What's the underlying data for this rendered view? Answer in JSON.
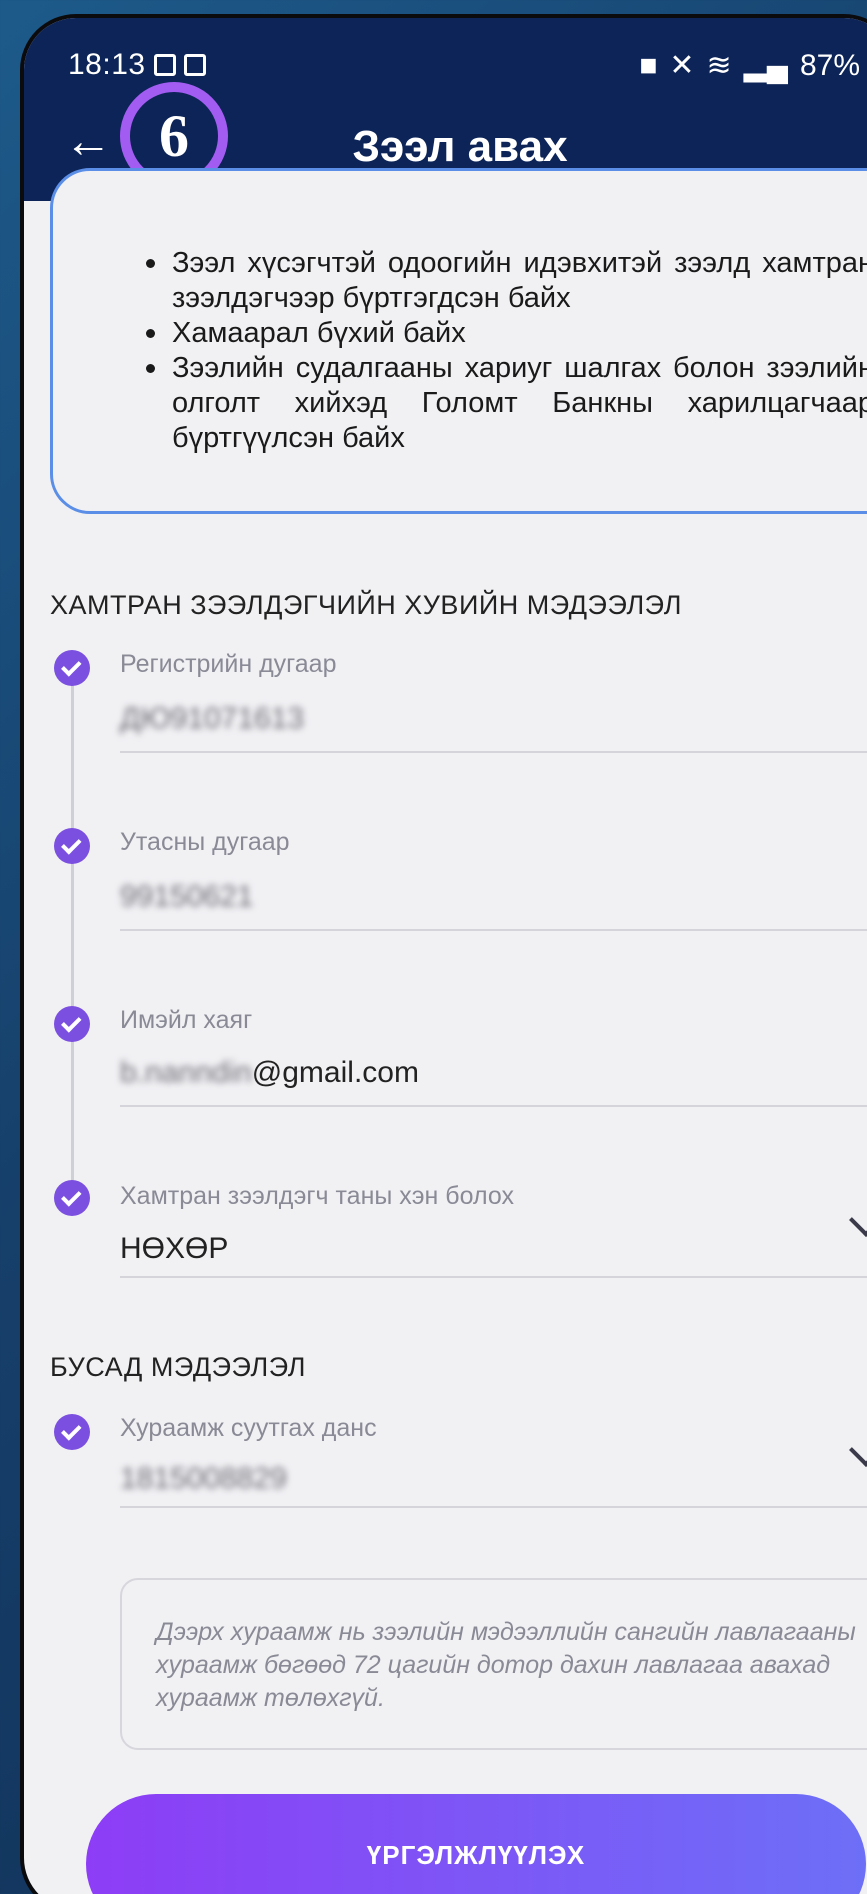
{
  "status_bar": {
    "time": "18:13",
    "battery": "87%"
  },
  "header": {
    "title": "Зээл авах",
    "step_badge": "6"
  },
  "requirements": [
    "Зээл хүсэгчтэй одоогийн идэвхитэй зээлд хамтран зээлдэгчээр бүртгэгдсэн байх",
    "Хамаарал бүхий байх",
    "Зээлийн судалгааны хариуг шалгах болон зээлийн олголт хийхэд Голомт Банкны харилцагчаар бүртгүүлсэн байх"
  ],
  "co_borrower": {
    "section_title": "ХАМТРАН ЗЭЭЛДЭГЧИЙН ХУВИЙН МЭДЭЭЛЭЛ",
    "register": {
      "label": "Регистрийн дугаар",
      "value": "ДЮ91071613"
    },
    "phone": {
      "label": "Утасны дугаар",
      "value": "99150621"
    },
    "email": {
      "label": "Имэйл хаяг",
      "value_hidden": "b.nanndin",
      "value_visible": "@gmail.com"
    },
    "relation": {
      "label": "Хамтран зээлдэгч таны хэн болох",
      "value": "НӨХӨР"
    }
  },
  "other": {
    "section_title": "БУСАД МЭДЭЭЛЭЛ",
    "account": {
      "label": "Хураамж суутгах данс",
      "value": "1815008829"
    }
  },
  "note": "Дээрх хураамж нь зээлийн мэдээллийн сангийн лавлагааны хураамж бөгөөд 72 цагийн дотор дахин лавлагаа авахад хураамж төлөхгүй.",
  "cta_label": "ҮРГЭЛЖЛҮҮЛЭХ",
  "colors": {
    "header": "#0c2457",
    "accent": "#7b4fe0",
    "cta_start": "#8d3df6",
    "cta_end": "#6d6ff7"
  }
}
